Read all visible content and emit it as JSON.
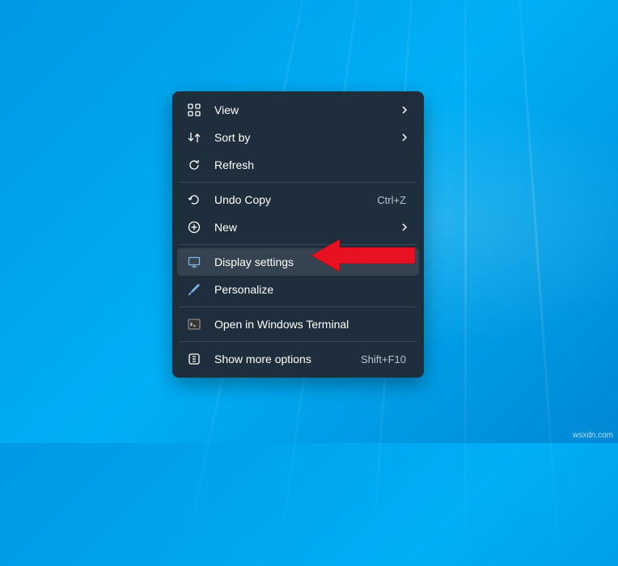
{
  "menu": {
    "view": "View",
    "sort_by": "Sort by",
    "refresh": "Refresh",
    "undo_copy": "Undo Copy",
    "undo_copy_shortcut": "Ctrl+Z",
    "new": "New",
    "display_settings": "Display settings",
    "personalize": "Personalize",
    "open_terminal": "Open in Windows Terminal",
    "show_more": "Show more options",
    "show_more_shortcut": "Shift+F10"
  },
  "watermark": "wsxdn.com"
}
